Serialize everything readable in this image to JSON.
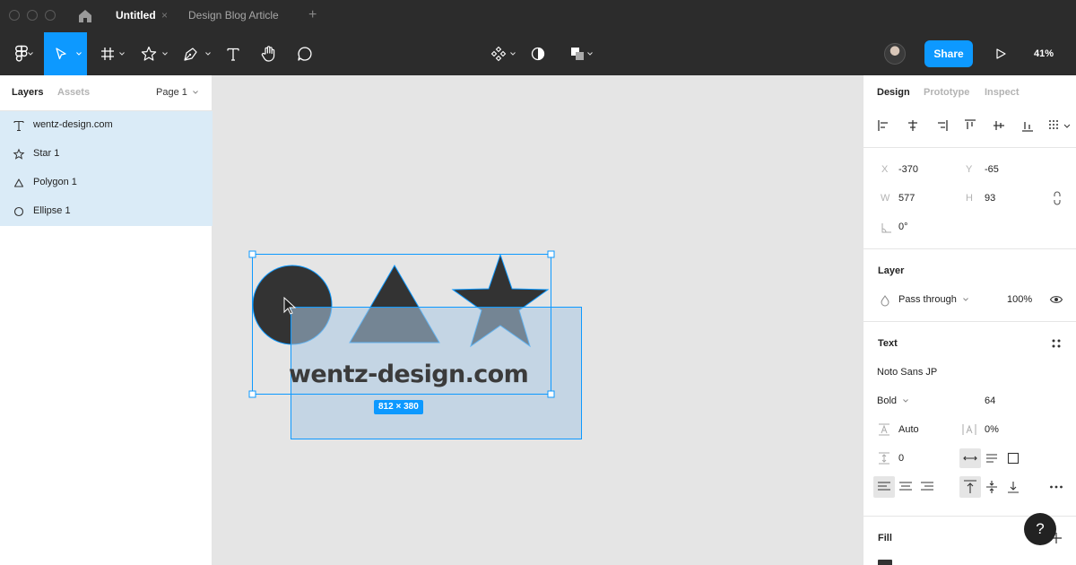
{
  "tabs": {
    "active": "Untitled",
    "other": "Design Blog Article",
    "close": "×",
    "add": "+"
  },
  "toolbar": {
    "share_label": "Share",
    "zoom": "41%",
    "colors": {
      "bar": "#2c2c2c",
      "accent": "#0d99ff"
    }
  },
  "left_panel": {
    "tab_layers": "Layers",
    "tab_assets": "Assets",
    "page": "Page 1",
    "layers": [
      {
        "icon": "text-icon",
        "name": "wentz-design.com"
      },
      {
        "icon": "star-icon",
        "name": "Star 1"
      },
      {
        "icon": "polygon-icon",
        "name": "Polygon 1"
      },
      {
        "icon": "ellipse-icon",
        "name": "Ellipse 1"
      }
    ]
  },
  "canvas": {
    "text": "wentz-design.com",
    "dimensions": "812 × 380"
  },
  "right_panel": {
    "tab_design": "Design",
    "tab_prototype": "Prototype",
    "tab_inspect": "Inspect",
    "x_label": "X",
    "x_value": "-370",
    "y_label": "Y",
    "y_value": "-65",
    "w_label": "W",
    "w_value": "577",
    "h_label": "H",
    "h_value": "93",
    "rotation": "0°",
    "layer_title": "Layer",
    "blend_mode": "Pass through",
    "opacity": "100%",
    "text_title": "Text",
    "font_family": "Noto Sans JP",
    "font_weight": "Bold",
    "font_size": "64",
    "line_height": "Auto",
    "letter_spacing": "0%",
    "paragraph_spacing": "0",
    "fill_title": "Fill",
    "help": "?"
  }
}
